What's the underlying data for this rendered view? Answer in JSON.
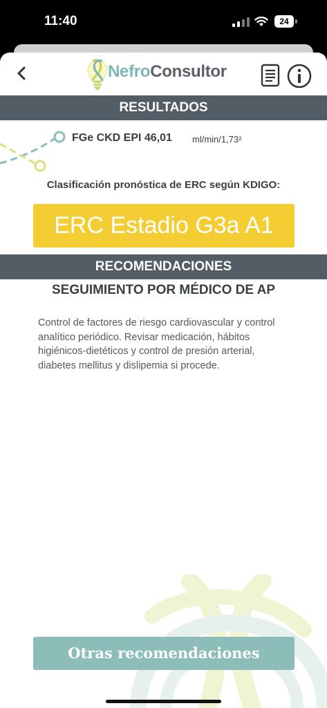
{
  "status_bar": {
    "time": "11:40",
    "battery": "24",
    "icons": [
      "signal-icon",
      "wifi-icon",
      "battery-icon"
    ]
  },
  "header": {
    "logo_part1": "Nefro",
    "logo_part2": "Consultor",
    "icons": [
      "back-chevron-icon",
      "lightbulb-logo-icon",
      "document-icon",
      "info-icon"
    ]
  },
  "results": {
    "title": "RESULTADOS",
    "fge_label": "FGe CKD EPI 46,01",
    "fge_unit": "ml/min/1,73²",
    "classification_label": "Clasificación pronóstica de ERC según KDIGO:",
    "stage": "ERC Estadio G3a A1"
  },
  "recommendations": {
    "title": "RECOMENDACIONES",
    "subtitle": "SEGUIMIENTO POR MÉDICO DE AP",
    "text": "Control de factores de riesgo cardiovascular y control analítico periódico. Revisar medicación, hábitos higiénicos-dietéticos y control de presión arterial, diabetes mellitus y dislipemia si procede."
  },
  "footer": {
    "button_label": "Otras recomendaciones"
  },
  "colors": {
    "header_bar": "#535d65",
    "stage_yellow": "#f3cd31",
    "button_teal": "#8cbdb8",
    "logo_teal": "#7ab8b3",
    "logo_gray": "#58616b"
  }
}
